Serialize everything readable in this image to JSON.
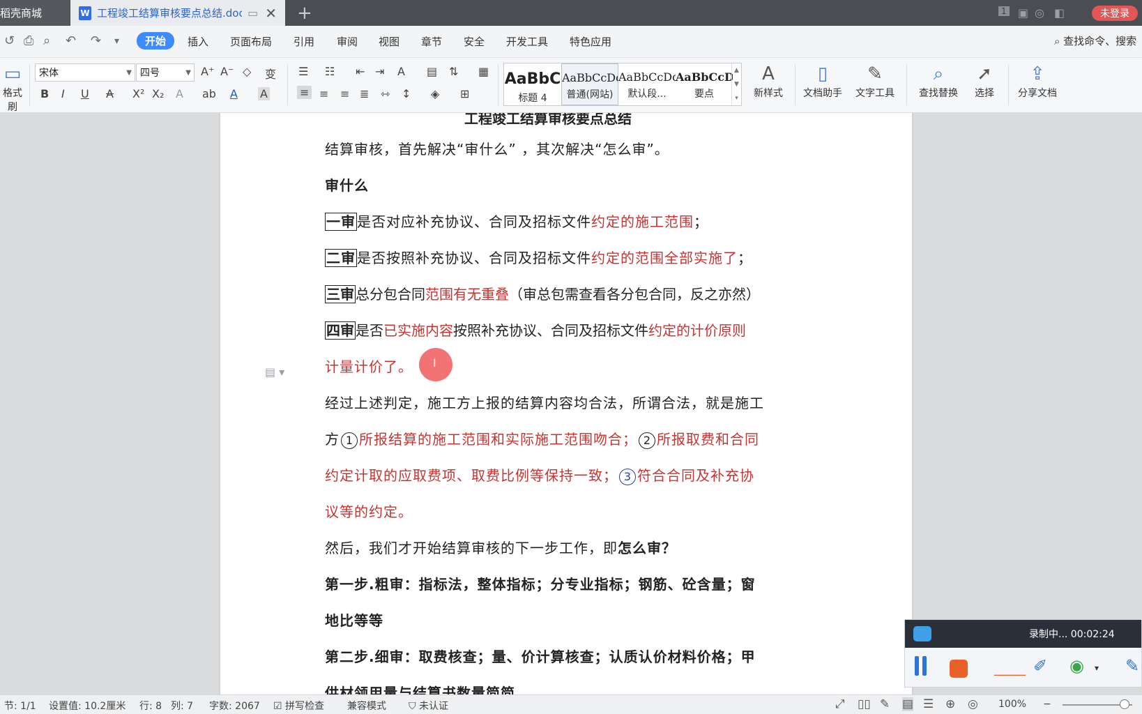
{
  "tabs": [
    {
      "label": "稻壳商城",
      "active": false
    },
    {
      "label": "工程竣工结算审核要点总结.doc",
      "active": true
    }
  ],
  "login_label": "未登录",
  "tab_counter": "1",
  "menu": {
    "items": [
      "开始",
      "插入",
      "页面布局",
      "引用",
      "审阅",
      "视图",
      "章节",
      "安全",
      "开发工具",
      "特色应用"
    ],
    "active": "开始",
    "search_placeholder": "查找命令、搜索"
  },
  "ribbon": {
    "format_painter": "格式刷",
    "font_name": "宋体",
    "font_size": "四号",
    "styles": [
      {
        "preview": "AaBbC",
        "name": "标题 4"
      },
      {
        "preview": "AaBbCcDd",
        "name": "普通(网站)"
      },
      {
        "preview": "AaBbCcDd",
        "name": "默认段..."
      },
      {
        "preview": "AaBbCcDd",
        "name": "要点"
      }
    ],
    "new_style": "新样式",
    "doc_assistant": "文档助手",
    "text_tools": "文字工具",
    "find_replace": "查找替换",
    "select": "选择",
    "share_doc": "分享文档"
  },
  "document": {
    "title": "工程竣工结算审核要点总结",
    "intro": "结算审核，首先解决“审什么” ，其次解决“怎么审”。",
    "heading1": "审什么",
    "r1": {
      "box": "一审",
      "text": "是否对应补充协议、合同及招标文件",
      "red": "约定的施工范围",
      "tail": "；"
    },
    "r2": {
      "box": "二审",
      "text": "是否按照补充协议、合同及招标文件",
      "red": "约定的范围全部实施了",
      "tail": "；"
    },
    "r3": {
      "box": "三审",
      "text": "总分包合同",
      "red": "范围有无重叠",
      "tail": "（审总包需查看各分包合同，反之亦然）"
    },
    "r4": {
      "box": "四审",
      "text": "是否",
      "red": "已实施内容",
      "mid": "按照补充协议、合同及招标文件",
      "red2": "约定的计价原则"
    },
    "r4b": "计量计价了。",
    "p2a": "经过上述判定，施工方上报的结算内容均合法，所谓合法，就是施工",
    "p2b_pre": "方",
    "c1": "1",
    "p2b_red1": "所报结算的施工范围和实际施工范围吻合；",
    "c2": "2",
    "p2b_red2": "所报取费和合同",
    "p2c_red": "约定计取的应取费项、取费比例等保持一致；",
    "c3": "3",
    "p2c_red2": "符合合同及补充协",
    "p2d_red": "议等的约定。",
    "p3_pre": "然后，我们才开始结算审核的下一步工作，即",
    "p3_bold": "怎么审？",
    "step1a": "第一步.粗审：指标法，整体指标；分专业指标；钢筋、砼含量；窗",
    "step1b": "地比等等",
    "step2a": "第二步.细审：取费核查；量、价计算核查；认质认价材料价格；甲",
    "step2b": "供材领用量与结算书数量简简"
  },
  "recorder": {
    "status": "录制中... 00:02:24"
  },
  "statusbar": {
    "section": "节: 1/1",
    "setting": "设置值: 10.2厘米",
    "row": "行: 8",
    "col": "列: 7",
    "words": "字数: 2067",
    "spell": "拼写检查",
    "compat": "兼容模式",
    "cert": "未认证",
    "zoom": "100%"
  }
}
